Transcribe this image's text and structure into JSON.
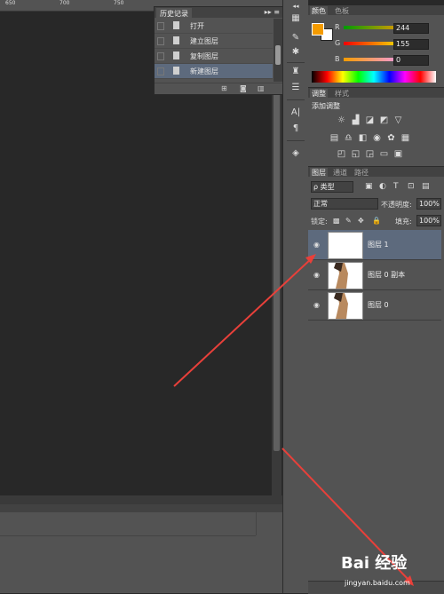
{
  "ruler": {
    "ticks": [
      "650",
      "700",
      "750"
    ]
  },
  "history": {
    "tab_label": "历史记录",
    "controls": "▸▸ ≡",
    "items": [
      {
        "label": "打开",
        "selected": false
      },
      {
        "label": "建立图层",
        "selected": false
      },
      {
        "label": "复制图层",
        "selected": false
      },
      {
        "label": "新建图层",
        "selected": true
      }
    ],
    "footer_icons": [
      "new-snapshot-icon",
      "camera-icon",
      "trash-icon"
    ]
  },
  "color_panel": {
    "tabs": [
      "颜色",
      "色板"
    ],
    "channels": [
      {
        "name": "R",
        "value": "244"
      },
      {
        "name": "G",
        "value": "155"
      },
      {
        "name": "B",
        "value": "0"
      }
    ],
    "foreground": "#f49b00",
    "background": "#ffffff"
  },
  "adjustments": {
    "tabs": [
      "调整",
      "样式"
    ],
    "title": "添加调整"
  },
  "layers": {
    "tabs": [
      "图层",
      "通道",
      "路径"
    ],
    "filter_kind": "ρ 类型",
    "blend_mode": "正常",
    "opacity_label": "不透明度:",
    "opacity_value": "100%",
    "lock_label": "锁定:",
    "fill_label": "填充:",
    "fill_value": "100%",
    "items": [
      {
        "name": "图层 1",
        "selected": true,
        "transparent": true
      },
      {
        "name": "图层 0 副本",
        "selected": false,
        "transparent": false
      },
      {
        "name": "图层 0",
        "selected": false,
        "transparent": false
      }
    ]
  },
  "watermark": {
    "brand": "Bai 经验",
    "url": "jingyan.baidu.com"
  },
  "colors": {
    "accent": "#e8403a",
    "selection": "#5d6a7d"
  }
}
